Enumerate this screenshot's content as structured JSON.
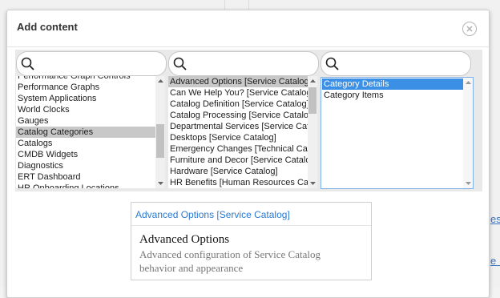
{
  "background": {
    "partial_link_1": "es",
    "partial_link_2": "e IF"
  },
  "dialog": {
    "title": "Add content"
  },
  "search": {
    "col1_value": "",
    "col2_value": "",
    "col3_value": ""
  },
  "column1": {
    "items": [
      {
        "label": "Performance Graph Controls"
      },
      {
        "label": "Performance Graphs"
      },
      {
        "label": "System Applications"
      },
      {
        "label": "World Clocks"
      },
      {
        "label": "Gauges"
      },
      {
        "label": "Catalog Categories",
        "selected": true
      },
      {
        "label": "Catalogs"
      },
      {
        "label": "CMDB Widgets"
      },
      {
        "label": "Diagnostics"
      },
      {
        "label": "ERT Dashboard"
      },
      {
        "label": "HR Onboarding Locations"
      }
    ]
  },
  "column2": {
    "items": [
      {
        "label": "Advanced Options [Service Catalog]",
        "selected": true
      },
      {
        "label": "Can We Help You? [Service Catalog]"
      },
      {
        "label": "Catalog Definition [Service Catalog]"
      },
      {
        "label": "Catalog Processing [Service Catalog]"
      },
      {
        "label": "Departmental Services [Service Catalog]"
      },
      {
        "label": "Desktops [Service Catalog]"
      },
      {
        "label": "Emergency Changes [Technical Catalog]"
      },
      {
        "label": "Furniture and Decor [Service Catalog]"
      },
      {
        "label": "Hardware [Service Catalog]"
      },
      {
        "label": "HR Benefits [Human Resources Catalog]"
      }
    ]
  },
  "column3": {
    "items": [
      {
        "label": "Category Details",
        "selected": true
      },
      {
        "label": "Category Items"
      }
    ]
  },
  "preview": {
    "header": "Advanced Options [Service Catalog]",
    "title": "Advanced Options",
    "description": "Advanced configuration of Service Catalog behavior and appearance"
  },
  "colors": {
    "accent": "#2b7bd0",
    "selection_blue": "#3b90e6",
    "selection_gray": "#c8c8c8"
  }
}
